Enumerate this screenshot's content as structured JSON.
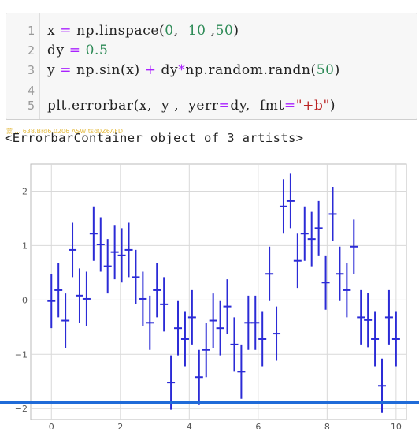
{
  "notebook": {
    "code_lines": [
      {
        "num": "1",
        "tokens": [
          {
            "t": "x ",
            "c": ""
          },
          {
            "t": "=",
            "c": "op"
          },
          {
            "t": " np.linspace(",
            "c": ""
          },
          {
            "t": "0",
            "c": "num"
          },
          {
            "t": ",  ",
            "c": ""
          },
          {
            "t": "10",
            "c": "num"
          },
          {
            "t": " ,",
            "c": ""
          },
          {
            "t": "50",
            "c": "num"
          },
          {
            "t": ")",
            "c": ""
          }
        ]
      },
      {
        "num": "2",
        "tokens": [
          {
            "t": "dy ",
            "c": ""
          },
          {
            "t": "=",
            "c": "op"
          },
          {
            "t": " ",
            "c": ""
          },
          {
            "t": "0.5",
            "c": "num"
          }
        ]
      },
      {
        "num": "3",
        "tokens": [
          {
            "t": "y ",
            "c": ""
          },
          {
            "t": "=",
            "c": "op"
          },
          {
            "t": " np.sin(x) ",
            "c": ""
          },
          {
            "t": "+",
            "c": "op"
          },
          {
            "t": " dy",
            "c": ""
          },
          {
            "t": "*",
            "c": "op"
          },
          {
            "t": "np.random.randn(",
            "c": ""
          },
          {
            "t": "50",
            "c": "num"
          },
          {
            "t": ")",
            "c": ""
          }
        ]
      },
      {
        "num": "4",
        "tokens": []
      },
      {
        "num": "5",
        "tokens": [
          {
            "t": "plt.errorbar(x,  y ,  yerr",
            "c": ""
          },
          {
            "t": "=",
            "c": "op"
          },
          {
            "t": "dy,  fmt",
            "c": ""
          },
          {
            "t": "=",
            "c": "op"
          },
          {
            "t": "\"+b\"",
            "c": "str"
          },
          {
            "t": ")",
            "c": ""
          }
        ]
      }
    ],
    "output_text": "<ErrorbarContainer object of 3 artists>",
    "overlay_text": "蒙 ... 638.Brd6.0206 ASW tsd0Z6AFD"
  },
  "colors": {
    "series": "#2b2bd6",
    "grid": "#d9d9d9",
    "number": "#2e8b57",
    "operator": "#aa22ff",
    "string": "#ba2121"
  },
  "chart_data": {
    "type": "scatter",
    "style": "errorbar",
    "marker": "+",
    "title": "",
    "xlabel": "",
    "ylabel": "",
    "xlim": [
      -0.6,
      10.3
    ],
    "ylim": [
      -2.2,
      2.5
    ],
    "xticks": [
      0,
      2,
      4,
      6,
      8,
      10
    ],
    "yticks": [
      -2,
      -1,
      0,
      1,
      2
    ],
    "grid": true,
    "series": [
      {
        "yerr": 0.5,
        "x": [
          0,
          0.2041,
          0.4082,
          0.6122,
          0.8163,
          1.0204,
          1.2245,
          1.4286,
          1.6327,
          1.8367,
          2.0408,
          2.2449,
          2.449,
          2.6531,
          2.8571,
          3.0612,
          3.2653,
          3.4694,
          3.6735,
          3.8776,
          4.0816,
          4.2857,
          4.4898,
          4.6939,
          4.898,
          5.102,
          5.3061,
          5.5102,
          5.7143,
          5.9184,
          6.1224,
          6.3265,
          6.5306,
          6.7347,
          6.9388,
          7.1429,
          7.3469,
          7.551,
          7.7551,
          7.9592,
          8.1633,
          8.3673,
          8.5714,
          8.7755,
          8.9796,
          9.1837,
          9.3878,
          9.5918,
          9.7959,
          10
        ],
        "y": [
          -0.02,
          0.18,
          -0.38,
          0.92,
          0.08,
          0.02,
          1.22,
          1.02,
          0.62,
          0.88,
          0.82,
          0.92,
          0.42,
          0.02,
          -0.42,
          0.18,
          -0.08,
          -1.52,
          -0.52,
          -0.72,
          -0.32,
          -1.42,
          -0.92,
          -0.38,
          -0.52,
          -0.12,
          -0.82,
          -1.32,
          -0.42,
          -0.42,
          -0.72,
          0.48,
          -0.62,
          1.72,
          1.82,
          0.72,
          1.22,
          1.12,
          1.32,
          0.32,
          1.58,
          0.48,
          0.18,
          0.98,
          -0.32,
          -0.37,
          -0.72,
          -1.58,
          -0.32,
          -0.72
        ]
      }
    ]
  }
}
